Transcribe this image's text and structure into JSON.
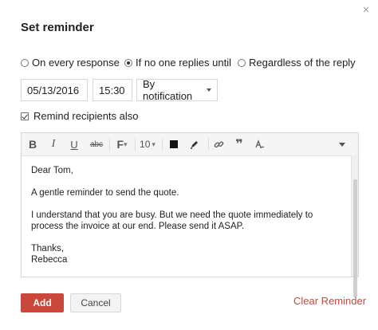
{
  "dialog": {
    "title": "Set reminder",
    "close_icon": "×"
  },
  "reminder_options": [
    {
      "label": "On every response",
      "checked": false
    },
    {
      "label": "If no one replies until",
      "checked": true
    },
    {
      "label": "Regardless of the reply",
      "checked": false
    }
  ],
  "schedule": {
    "date": "05/13/2016",
    "time": "15:30",
    "method": "By notification"
  },
  "remind_recipients": {
    "label": "Remind recipients also",
    "checked": true
  },
  "toolbar": {
    "bold": "B",
    "italic": "I",
    "underline": "U",
    "strike": "abc",
    "font": "F",
    "font_size": "10",
    "color": "#111111",
    "quote": "❞"
  },
  "message": {
    "greeting": "Dear Tom,",
    "line1": "A gentle reminder to send the quote.",
    "line2": "I understand that you are busy. But we need the quote immediately to process the invoice at our end. Please send it ASAP.",
    "closing": "Thanks,",
    "signature": "Rebecca"
  },
  "actions": {
    "add": "Add",
    "cancel": "Cancel",
    "clear": "Clear Reminder"
  },
  "colors": {
    "accent": "#c9473b"
  }
}
